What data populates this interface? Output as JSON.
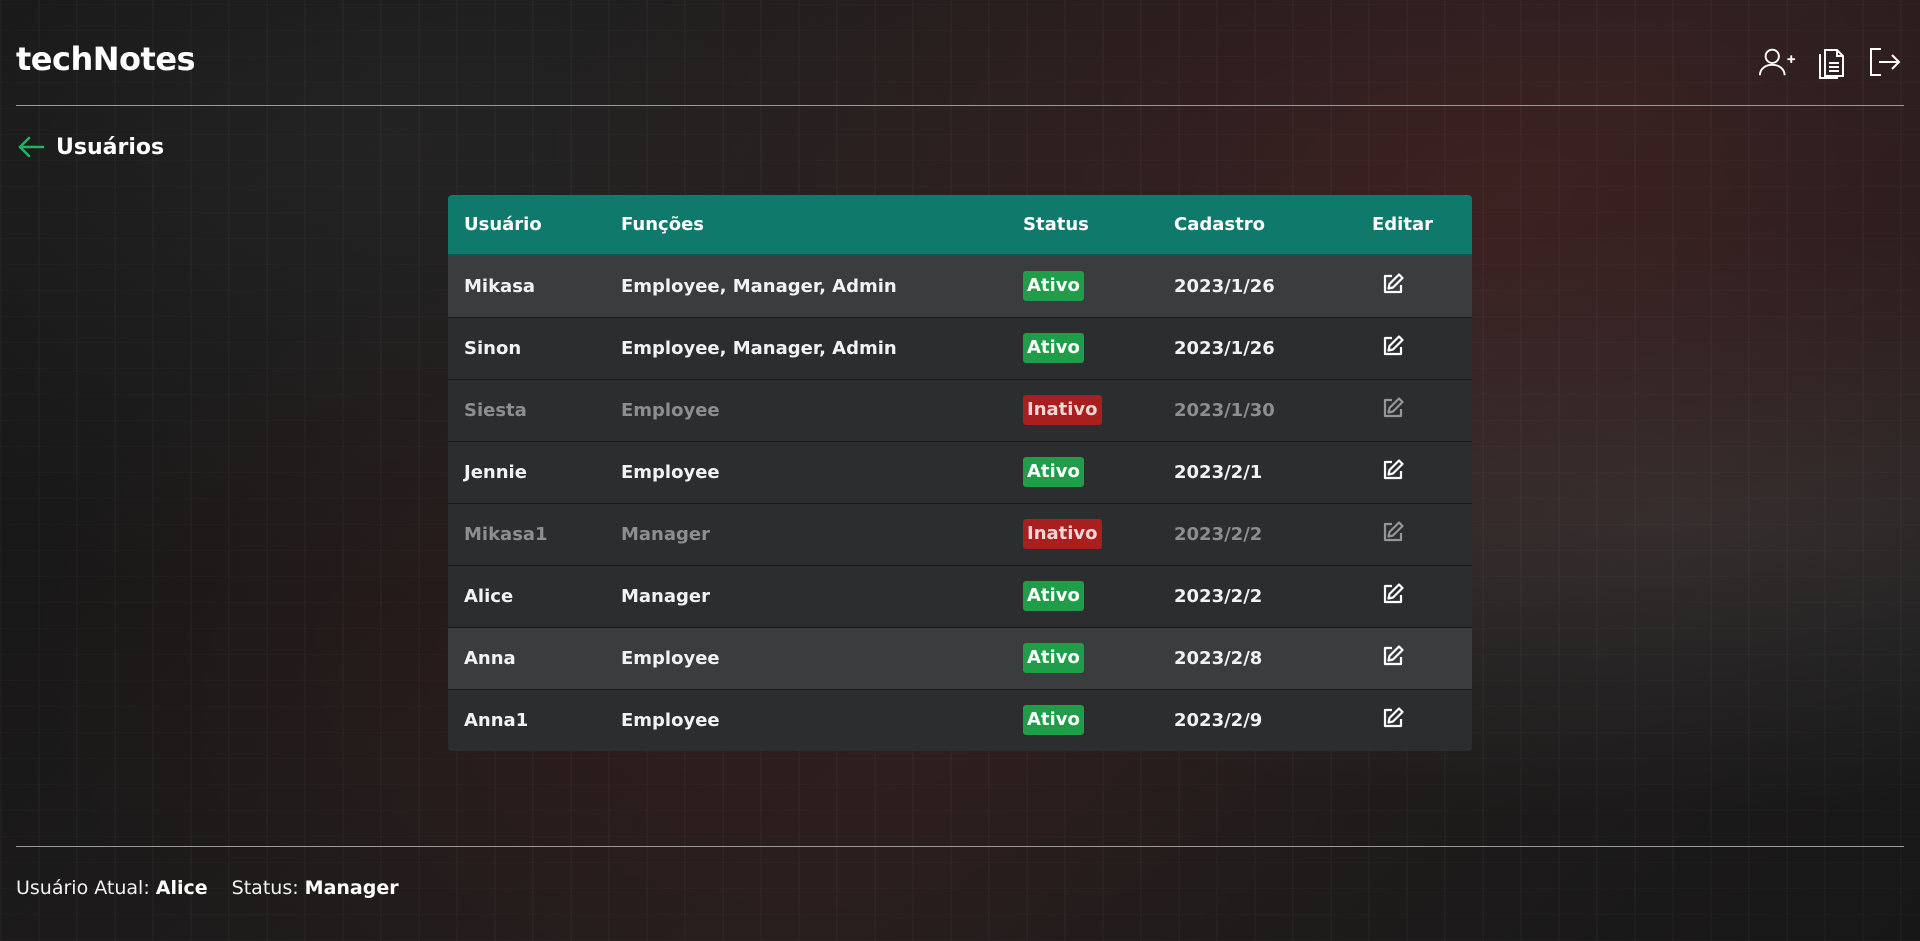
{
  "app": {
    "title": "techNotes"
  },
  "header": {
    "actions": [
      {
        "icon": "add-user-icon"
      },
      {
        "icon": "notes-icon"
      },
      {
        "icon": "logout-icon"
      }
    ]
  },
  "page": {
    "title": "Usuários",
    "back_icon": "arrow-left-icon",
    "accent_color": "#1fb560"
  },
  "table": {
    "columns": [
      "Usuário",
      "Funções",
      "Status",
      "Cadastro",
      "Editar"
    ],
    "header_color": "#0f7a6c",
    "rows": [
      {
        "user": "Mikasa",
        "roles": "Employee, Manager, Admin",
        "status": "Ativo",
        "active": true,
        "created": "2023/1/26"
      },
      {
        "user": "Sinon",
        "roles": "Employee, Manager, Admin",
        "status": "Ativo",
        "active": true,
        "created": "2023/1/26"
      },
      {
        "user": "Siesta",
        "roles": "Employee",
        "status": "Inativo",
        "active": false,
        "created": "2023/1/30"
      },
      {
        "user": "Jennie",
        "roles": "Employee",
        "status": "Ativo",
        "active": true,
        "created": "2023/2/1"
      },
      {
        "user": "Mikasa1",
        "roles": "Manager",
        "status": "Inativo",
        "active": false,
        "created": "2023/2/2"
      },
      {
        "user": "Alice",
        "roles": "Manager",
        "status": "Ativo",
        "active": true,
        "created": "2023/2/2"
      },
      {
        "user": "Anna",
        "roles": "Employee",
        "status": "Ativo",
        "active": true,
        "created": "2023/2/8"
      },
      {
        "user": "Anna1",
        "roles": "Employee",
        "status": "Ativo",
        "active": true,
        "created": "2023/2/9"
      }
    ]
  },
  "footer": {
    "current_user_label": "Usuário Atual:",
    "current_user": "Alice",
    "status_label": "Status:",
    "status": "Manager"
  }
}
